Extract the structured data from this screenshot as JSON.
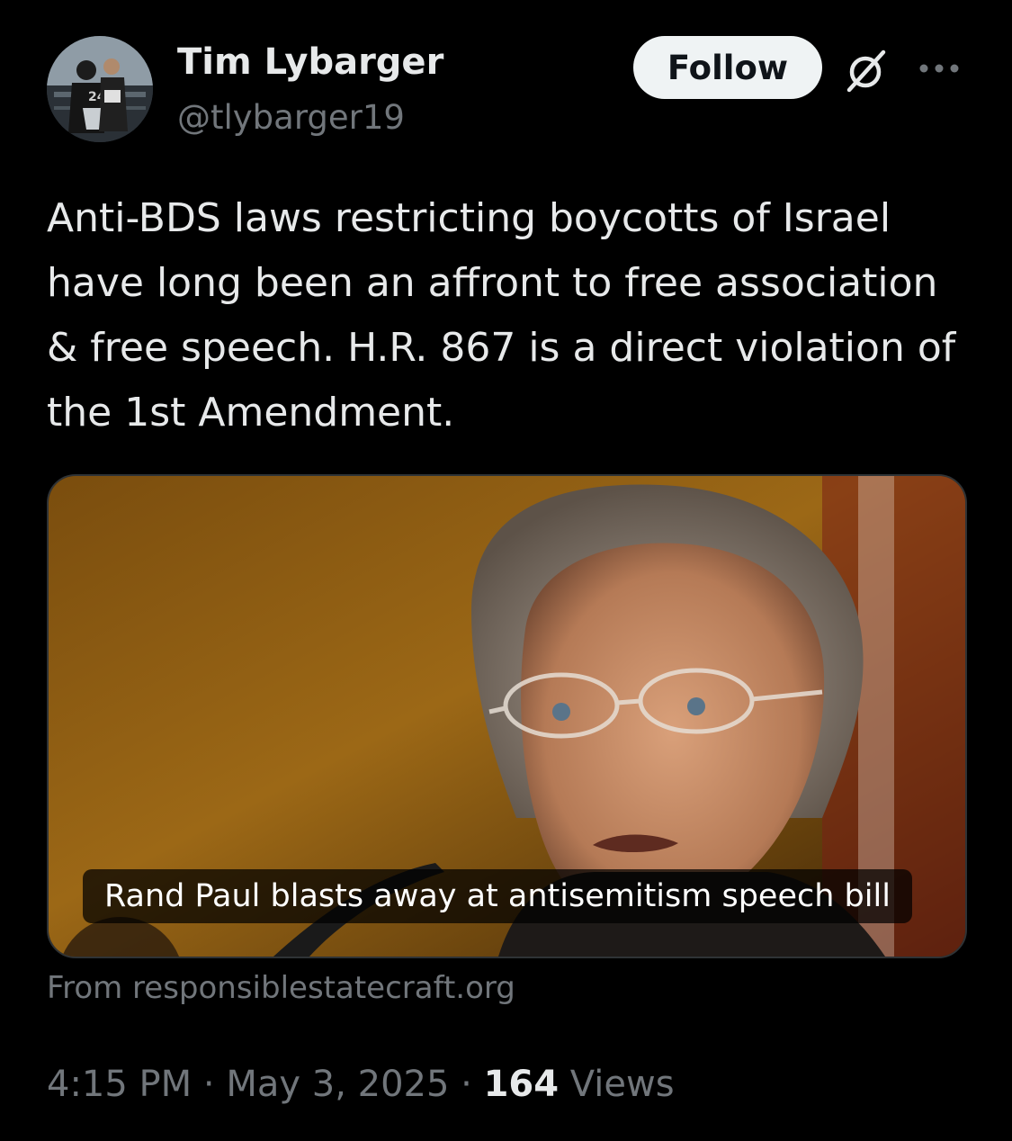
{
  "author": {
    "name": "Tim Lybarger",
    "handle": "@tlybarger19"
  },
  "actions": {
    "follow_label": "Follow"
  },
  "tweet": {
    "text": "Anti-BDS laws restricting boycotts of Israel have long been an affront to free association & free speech. H.R. 867 is a direct violation of the 1st Amendment."
  },
  "link_card": {
    "caption": "Rand Paul blasts away at antisemitism speech bill",
    "source": "From responsiblestatecraft.org"
  },
  "meta": {
    "time": "4:15 PM",
    "separator": "·",
    "date": "May 3, 2025",
    "views_count": "164",
    "views_label": "Views"
  },
  "icons": [
    "grok-icon",
    "more-icon"
  ],
  "colors": {
    "background": "#000000",
    "primary_text": "#e7e9ea",
    "secondary_text": "#71767b",
    "follow_button_bg": "#eff3f4",
    "border": "#2f3336"
  }
}
